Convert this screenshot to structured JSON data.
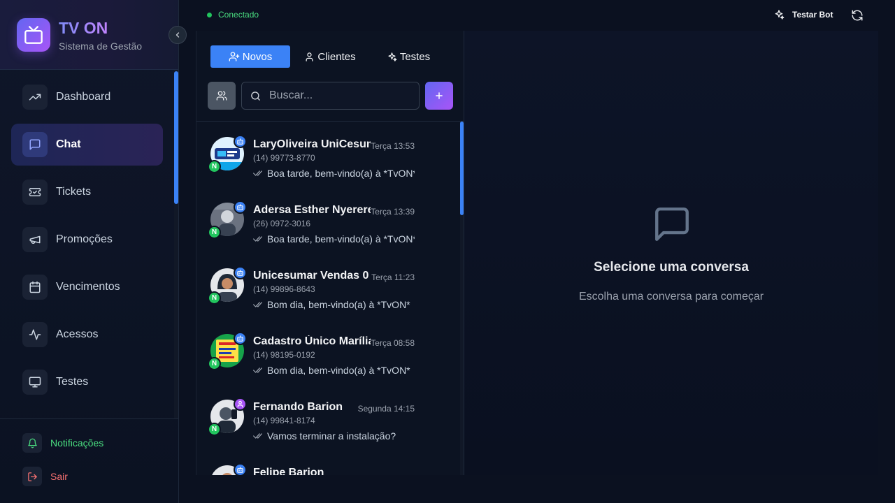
{
  "app": {
    "title": "TV ON",
    "subtitle": "Sistema de Gestão"
  },
  "sidebar": {
    "items": [
      {
        "label": "Dashboard",
        "icon": "trending-up-icon"
      },
      {
        "label": "Chat",
        "icon": "message-square-icon",
        "active": true
      },
      {
        "label": "Tickets",
        "icon": "ticket-icon"
      },
      {
        "label": "Promoções",
        "icon": "megaphone-icon"
      },
      {
        "label": "Vencimentos",
        "icon": "calendar-icon"
      },
      {
        "label": "Acessos",
        "icon": "activity-icon"
      },
      {
        "label": "Testes",
        "icon": "monitor-icon"
      }
    ],
    "notifications_label": "Notificações",
    "logout_label": "Sair"
  },
  "topbar": {
    "status": "Conectado",
    "test_bot_label": "Testar Bot"
  },
  "chat_list": {
    "tabs": [
      {
        "label": "Novos",
        "active": true
      },
      {
        "label": "Clientes"
      },
      {
        "label": "Testes"
      }
    ],
    "search_placeholder": "Buscar...",
    "conversations": [
      {
        "name": "LaryOliveira UniCesumar",
        "phone": "(14) 99773-8770",
        "time": "Terça 13:53",
        "message": "Boa tarde, bem-vindo(a) à *TvON*",
        "badge": "bot",
        "tag": "N"
      },
      {
        "name": "Adersa Esther Nyerere",
        "phone": "(26) 0972-3016",
        "time": "Terça 13:39",
        "message": "Boa tarde, bem-vindo(a) à *TvON*",
        "badge": "bot",
        "tag": "N"
      },
      {
        "name": "Unicesumar Vendas 0",
        "phone": "(14) 99896-8643",
        "time": "Terça 11:23",
        "message": "Bom dia, bem-vindo(a) à *TvON*",
        "badge": "bot",
        "tag": "N"
      },
      {
        "name": "Cadastro Único Marília",
        "phone": "(14) 98195-0192",
        "time": "Terça 08:58",
        "message": "Bom dia, bem-vindo(a) à *TvON*",
        "badge": "bot",
        "tag": "N"
      },
      {
        "name": "Fernando Barion",
        "phone": "(14) 99841-8174",
        "time": "Segunda 14:15",
        "message": "Vamos terminar a instalação?",
        "badge": "user",
        "tag": "N"
      },
      {
        "name": "Felipe Barion",
        "phone": "",
        "time": "",
        "message": "",
        "badge": "bot",
        "tag": "N"
      }
    ]
  },
  "empty_state": {
    "title": "Selecione uma conversa",
    "subtitle": "Escolha uma conversa para começar"
  },
  "colors": {
    "accent": "#3b82f6",
    "brand_gradient_start": "#6366f1",
    "brand_gradient_end": "#a855f7",
    "online": "#22c55e",
    "danger": "#f87171"
  }
}
